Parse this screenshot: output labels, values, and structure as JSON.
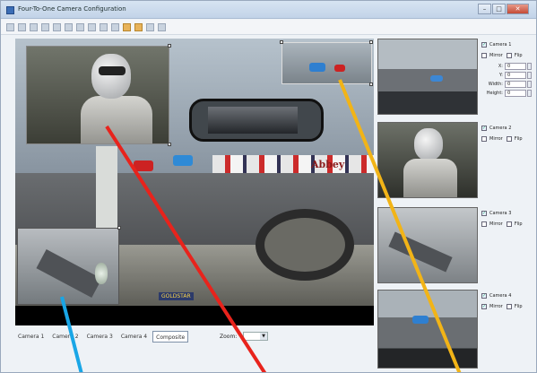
{
  "window": {
    "title": "Four-To-One Camera Configuration"
  },
  "titlebar_controls": {
    "minimize": "–",
    "maximize": "□",
    "close": "✕"
  },
  "toolbar": {
    "icons": [
      "new-icon",
      "open-icon",
      "save-icon",
      "print-icon",
      "cut-icon",
      "copy-icon",
      "paste-icon",
      "grid-icon",
      "layout-icon",
      "tile-icon",
      "capture-icon",
      "snapshot-icon",
      "undo-icon",
      "redo-icon"
    ]
  },
  "canvas": {
    "sign_text": "Abbey",
    "dash_badge": "GOLDSTAR"
  },
  "view_buttons": [
    {
      "label": "Camera 1",
      "active": false
    },
    {
      "label": "Camera 2",
      "active": false
    },
    {
      "label": "Camera 3",
      "active": false
    },
    {
      "label": "Camera 4",
      "active": false
    },
    {
      "label": "Composite",
      "active": true
    }
  ],
  "zoom": {
    "label": "Zoom:",
    "value": ""
  },
  "cameras": [
    {
      "name": "Camera 1",
      "checked": true,
      "mirror_label": "Mirror",
      "flip_label": "Flip",
      "fields": [
        {
          "label": "X:",
          "value": "0"
        },
        {
          "label": "Y:",
          "value": "0"
        },
        {
          "label": "Width:",
          "value": "0"
        },
        {
          "label": "Height:",
          "value": "0"
        }
      ]
    },
    {
      "name": "Camera 2",
      "checked": true,
      "mirror_label": "Mirror",
      "flip_label": "Flip"
    },
    {
      "name": "Camera 3",
      "checked": true,
      "mirror_label": "Mirror",
      "flip_label": "Flip"
    },
    {
      "name": "Camera 4",
      "checked": true,
      "mirror_label": "Mirror",
      "flip_label": "Flip",
      "mirror_checked": true
    }
  ],
  "annotation_colors": {
    "red": "#e8231c",
    "orange": "#f2b417",
    "blue": "#19a6e6"
  },
  "check_glyph": "✓"
}
